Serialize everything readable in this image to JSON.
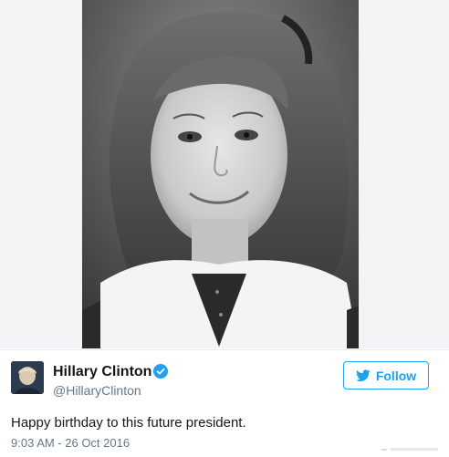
{
  "tweet": {
    "author_name": "Hillary Clinton",
    "author_handle": "@HillaryClinton",
    "text": "Happy birthday to this future president.",
    "timestamp": "9:03 AM - 26 Oct 2016",
    "verified": true
  },
  "follow_button": {
    "label": "Follow",
    "icon": "twitter-bird-icon"
  },
  "colors": {
    "accent": "#1da1f2",
    "text": "#14171a",
    "muted": "#657786",
    "page_background": "#f1f3f4"
  }
}
